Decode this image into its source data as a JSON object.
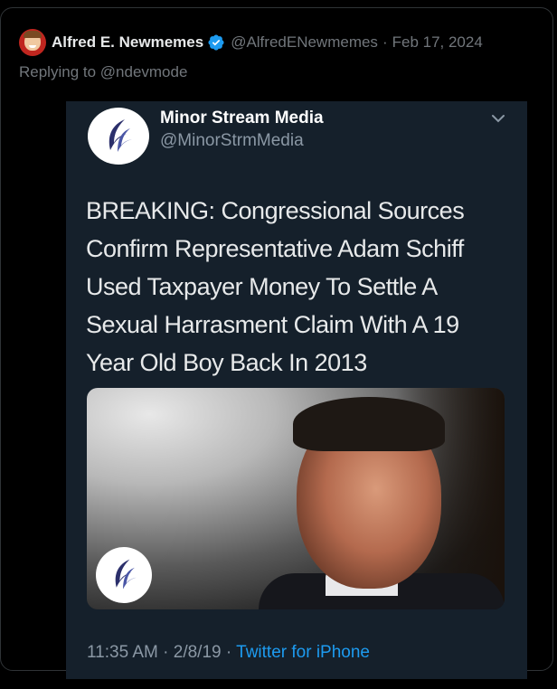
{
  "tweet": {
    "author_name": "Alfred E. Newmemes",
    "author_handle": "@AlfredENewmemes",
    "separator": "·",
    "date": "Feb 17, 2024",
    "replying_to": "Replying to @ndevmode",
    "avatar_icon": "mad-magazine-avatar",
    "verified_icon": "verified-badge-icon",
    "verified_color": "#1d9bf0"
  },
  "embedded": {
    "account_name": "Minor Stream Media",
    "account_handle": "@MinorStrmMedia",
    "logo_icon": "minor-stream-media-logo",
    "headline_lines": [
      "BREAKING: Congressional Sources",
      "Confirm Representative Adam Schiff",
      "Used Taxpayer Money To Settle A",
      "Sexual Harrasment Claim With A 19",
      "Year Old Boy Back In 2013"
    ],
    "time": "11:35 AM",
    "separator": "·",
    "date": "2/8/19",
    "source": "Twitter for iPhone",
    "background_color": "#15202b",
    "link_color": "#1d9bf0"
  }
}
